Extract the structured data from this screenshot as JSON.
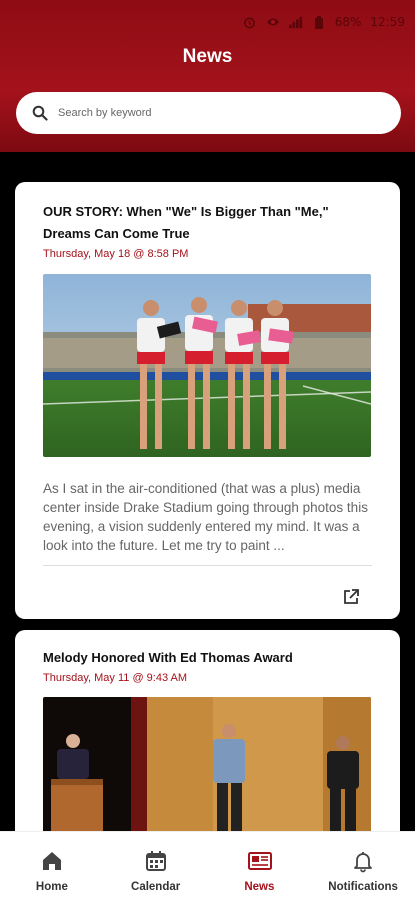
{
  "status_bar": {
    "battery": "68%",
    "time": "12:59"
  },
  "header": {
    "title": "News"
  },
  "search": {
    "placeholder": "Search by keyword"
  },
  "articles": [
    {
      "title": "OUR STORY: When \"We\" Is Bigger Than \"Me,\" Dreams Can Come True",
      "date": "Thursday, May 18 @ 8:58 PM",
      "excerpt": "As I sat in the air-conditioned (that was a plus) media center inside Drake Stadium going through photos this evening, a vision suddenly entered my mind. It was a look into the future. Let me try to paint ..."
    },
    {
      "title": "Melody Honored With Ed Thomas Award",
      "date": "Thursday, May 11 @ 9:43 AM"
    }
  ],
  "tabs": [
    {
      "label": "Home",
      "icon": "home-icon"
    },
    {
      "label": "Calendar",
      "icon": "calendar-icon"
    },
    {
      "label": "News",
      "icon": "newspaper-icon",
      "active": true
    },
    {
      "label": "Notifications",
      "icon": "bell-icon"
    }
  ],
  "colors": {
    "brand": "#a4121b",
    "header_dark": "#7d0a11"
  }
}
